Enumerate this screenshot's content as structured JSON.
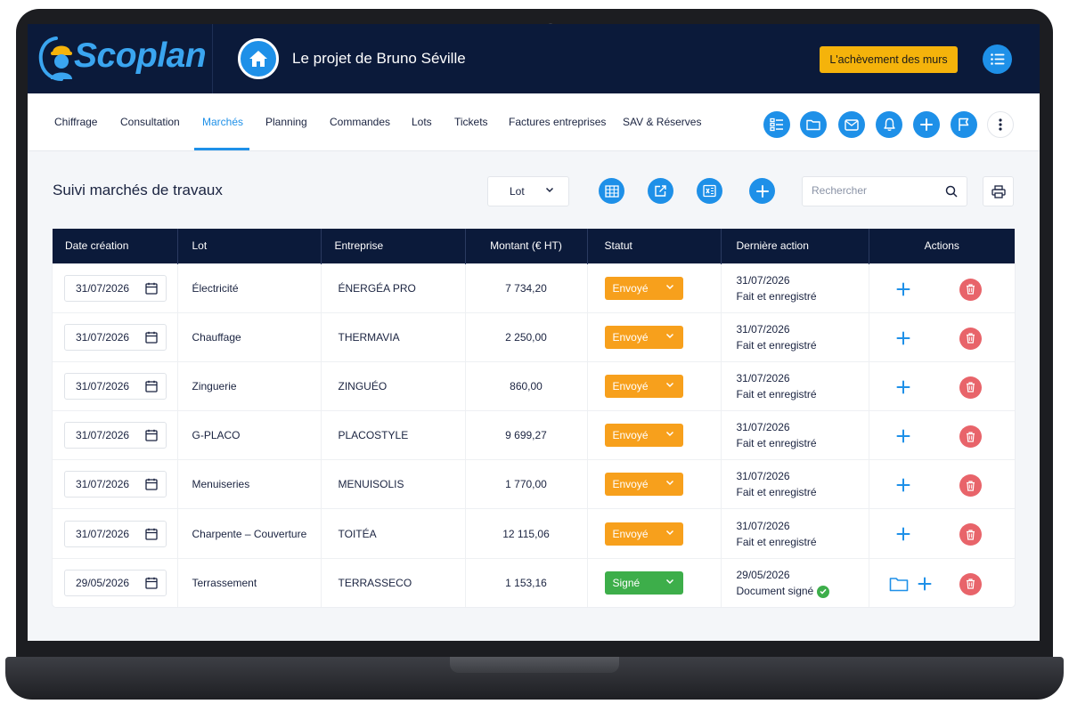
{
  "header": {
    "logo_text": "Scoplan",
    "project_title": "Le projet de Bruno Séville",
    "milestone_label": "L'achèvement des murs"
  },
  "nav": {
    "tabs": [
      {
        "label": "Chiffrage"
      },
      {
        "label": "Consultation"
      },
      {
        "label": "Marchés",
        "active": true
      },
      {
        "label": "Planning"
      },
      {
        "label": "Commandes"
      },
      {
        "label": "Lots"
      },
      {
        "label": "Tickets"
      },
      {
        "label": "Factures entreprises"
      },
      {
        "label": "SAV & Réserves"
      }
    ],
    "icons": [
      "checklist-icon",
      "folder-icon",
      "mail-icon",
      "bell-icon",
      "plus-icon",
      "flag-icon",
      "more-vertical-icon"
    ]
  },
  "toolbar": {
    "title": "Suivi marchés de travaux",
    "lot_filter": "Lot",
    "search_placeholder": "Rechercher",
    "icons": [
      "table-icon",
      "export-icon",
      "excel-icon",
      "plus-icon",
      "print-icon"
    ]
  },
  "table": {
    "headers": [
      "Date création",
      "Lot",
      "Entreprise",
      "Montant (€ HT)",
      "Statut",
      "Dernière action",
      "Actions"
    ],
    "rows": [
      {
        "date": "31/07/2026",
        "lot": "Électricité",
        "company": "ÉNERGÉA PRO",
        "amount": "7 734,20",
        "status": "Envoyé",
        "last_date": "31/07/2026",
        "last_action": "Fait et enregistré"
      },
      {
        "date": "31/07/2026",
        "lot": "Chauffage",
        "company": "THERMAVIA",
        "amount": "2 250,00",
        "status": "Envoyé",
        "last_date": "31/07/2026",
        "last_action": "Fait et enregistré"
      },
      {
        "date": "31/07/2026",
        "lot": "Zinguerie",
        "company": "ZINGUÉO",
        "amount": "860,00",
        "status": "Envoyé",
        "last_date": "31/07/2026",
        "last_action": "Fait et enregistré"
      },
      {
        "date": "31/07/2026",
        "lot": "G-PLACO",
        "company": "PLACOSTYLE",
        "amount": "9 699,27",
        "status": "Envoyé",
        "last_date": "31/07/2026",
        "last_action": "Fait et enregistré"
      },
      {
        "date": "31/07/2026",
        "lot": "Menuiseries",
        "company": "MENUISOLIS",
        "amount": "1 770,00",
        "status": "Envoyé",
        "last_date": "31/07/2026",
        "last_action": "Fait et enregistré"
      },
      {
        "date": "31/07/2026",
        "lot": "Charpente – Couverture",
        "company": "TOITÉA",
        "amount": "12 115,06",
        "status": "Envoyé",
        "last_date": "31/07/2026",
        "last_action": "Fait et enregistré"
      },
      {
        "date": "29/05/2026",
        "lot": "Terrassement",
        "company": "TERRASSECO",
        "amount": "1 153,16",
        "status": "Signé",
        "last_date": "29/05/2026",
        "last_action": "Document signé",
        "signed": true
      }
    ]
  },
  "colors": {
    "navy": "#0b1a3a",
    "accent_blue": "#1e90e8",
    "status_sent": "#f7a01c",
    "status_signed": "#3dae4a",
    "milestone_yellow": "#f5b30b",
    "delete_red": "#e8646a"
  }
}
